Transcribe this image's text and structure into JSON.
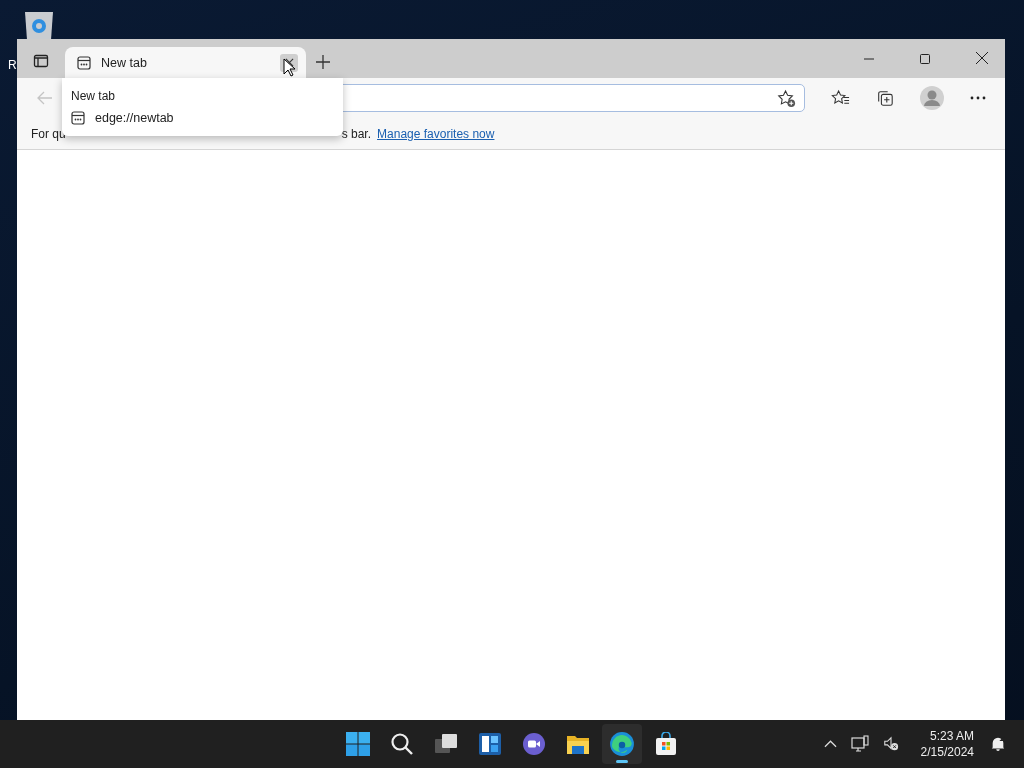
{
  "desktop": {
    "icons": [
      {
        "label": "R"
      }
    ]
  },
  "browser": {
    "tabs": [
      {
        "title": "New tab",
        "selected": true,
        "close_hovered": true
      }
    ],
    "hover_card": {
      "title": "New tab",
      "url": "edge://newtab"
    },
    "back_button": {
      "disabled": true
    },
    "favorites_bar": {
      "texts": [
        "For qu",
        "s bar."
      ],
      "link": "Manage favorites now"
    }
  },
  "taskbar": {
    "apps": [
      {
        "kind": "start",
        "selected": false
      },
      {
        "kind": "search",
        "selected": false
      },
      {
        "kind": "taskview",
        "selected": false
      },
      {
        "kind": "widgets",
        "selected": false
      },
      {
        "kind": "chat",
        "selected": false
      },
      {
        "kind": "explorer",
        "selected": false
      },
      {
        "kind": "edge",
        "selected": true
      },
      {
        "kind": "store",
        "selected": false
      }
    ],
    "clock": {
      "time": "5:23 AM",
      "date": "2/15/2024"
    }
  }
}
